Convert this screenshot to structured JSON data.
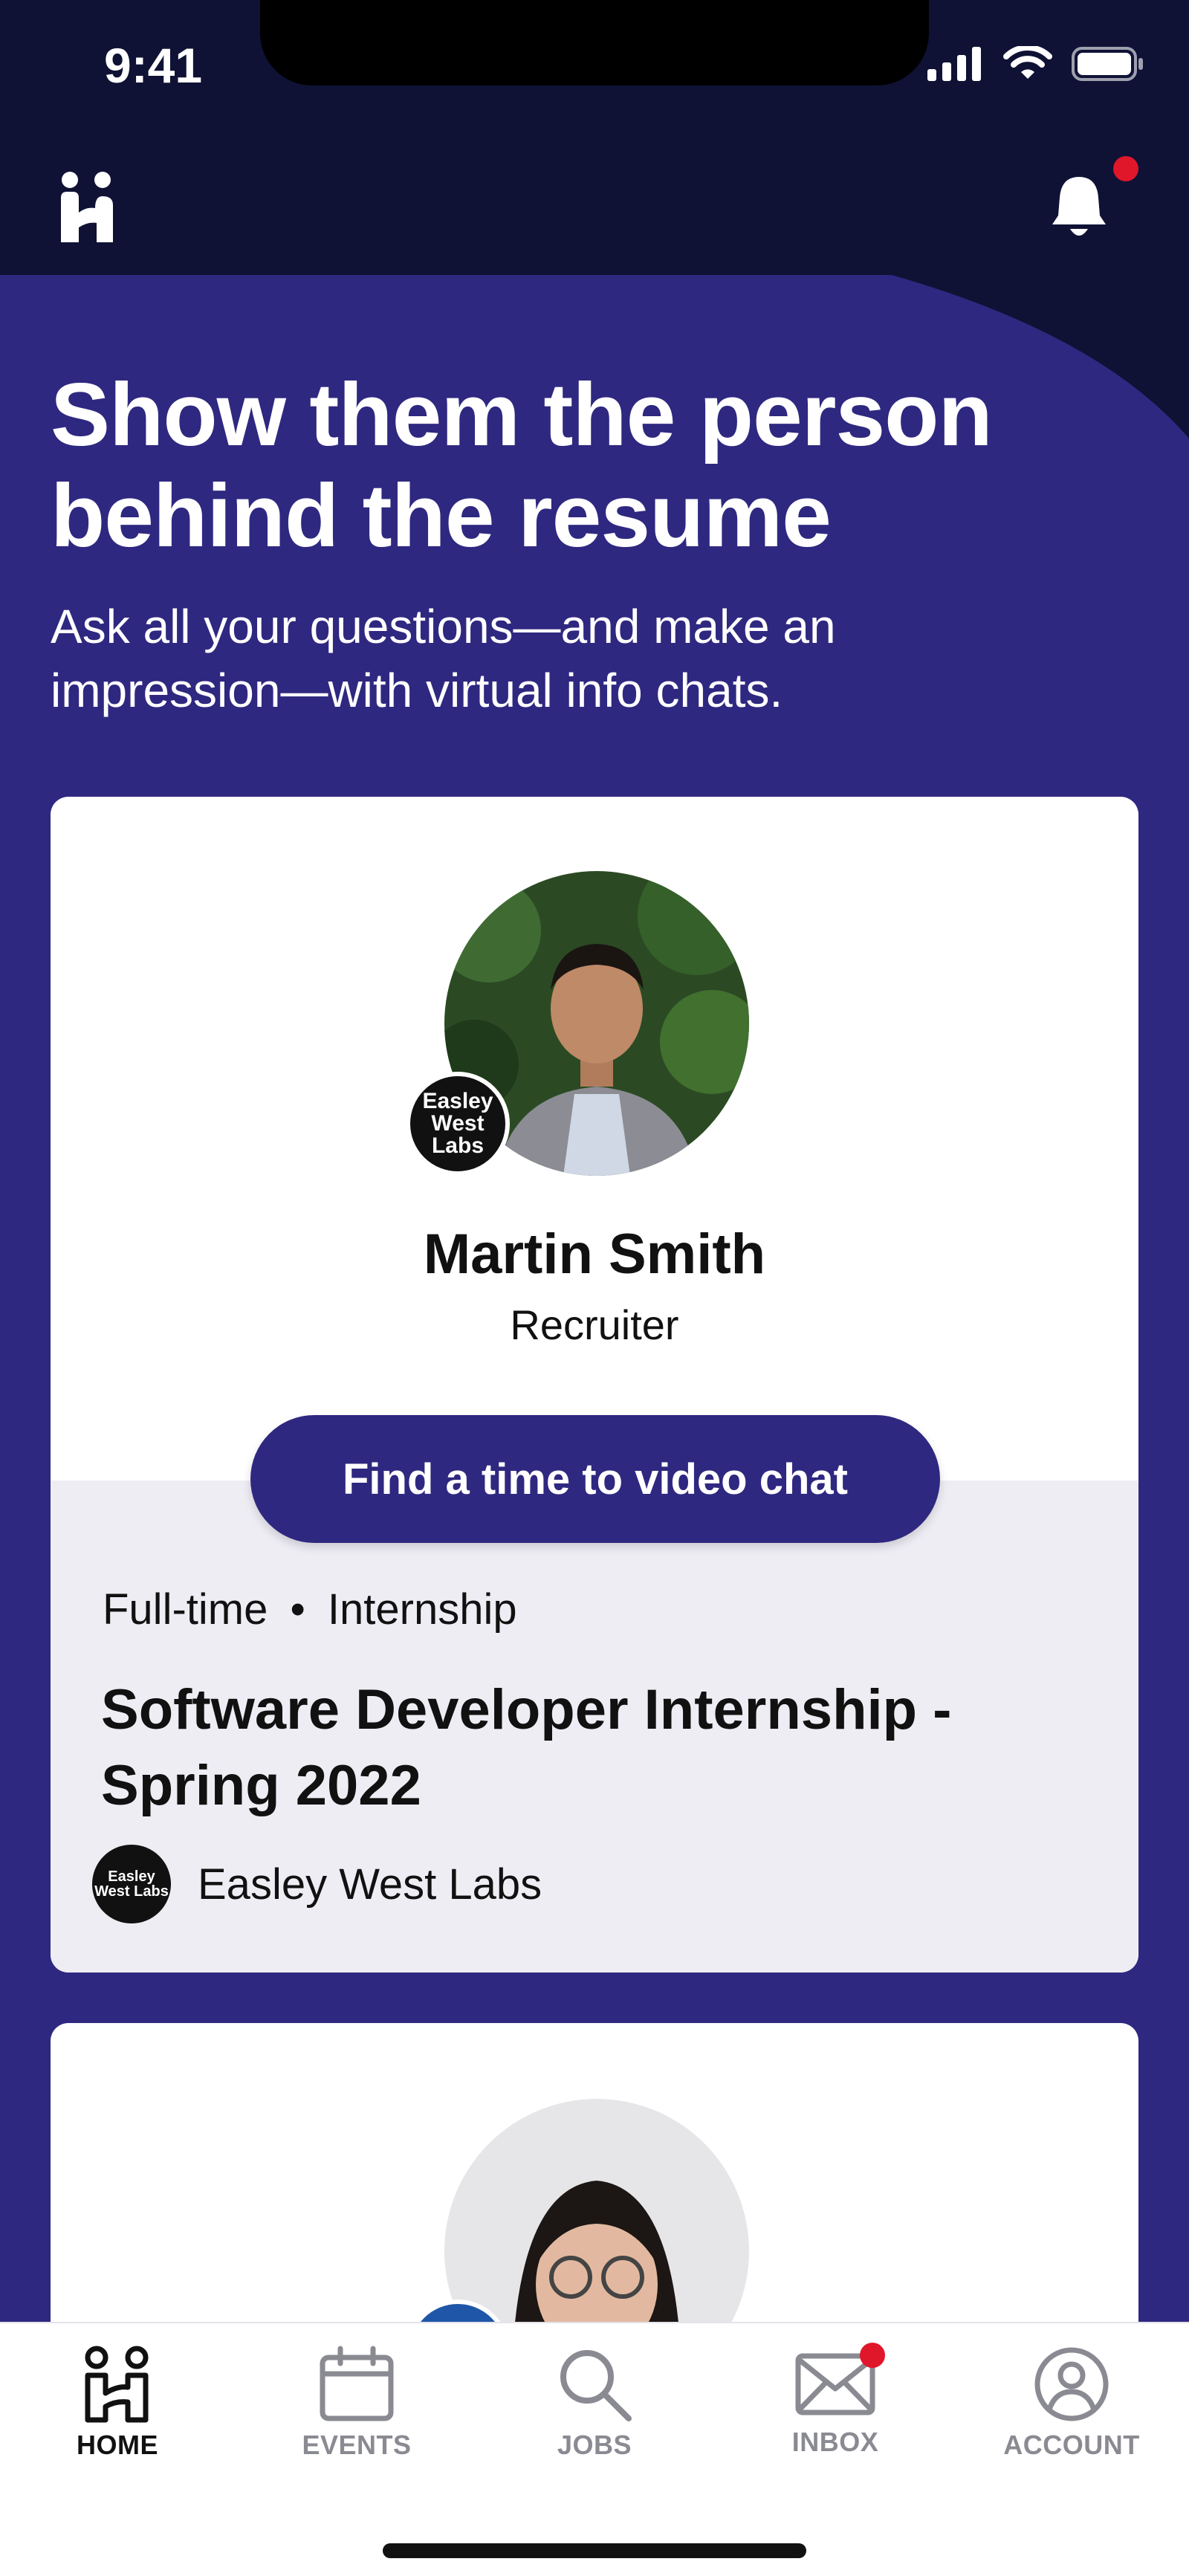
{
  "status_bar": {
    "time": "9:41"
  },
  "hero": {
    "title": "Show them the person behind the resume",
    "subtitle": "Ask all your questions—and make an impression—with virtual info chats."
  },
  "cards": [
    {
      "person_name": "Martin Smith",
      "person_role": "Recruiter",
      "logo_text": "Easley West Labs",
      "cta_label": "Find a time to video chat",
      "job_type": "Full-time",
      "job_kind": "Internship",
      "job_separator": "•",
      "job_title": "Software Developer Internship - Spring 2022",
      "company_name": "Easley West Labs"
    }
  ],
  "tabbar": {
    "items": [
      {
        "label": "HOME",
        "icon": "home-icon",
        "active": true
      },
      {
        "label": "EVENTS",
        "icon": "calendar-icon"
      },
      {
        "label": "JOBS",
        "icon": "search-icon"
      },
      {
        "label": "INBOX",
        "icon": "envelope-icon",
        "badge": true
      },
      {
        "label": "ACCOUNT",
        "icon": "user-icon"
      }
    ]
  },
  "colors": {
    "brand_dark": "#0f1235",
    "brand_purple": "#2f2880",
    "notification_red": "#e0162b",
    "card_bottom": "#eeedf4"
  }
}
